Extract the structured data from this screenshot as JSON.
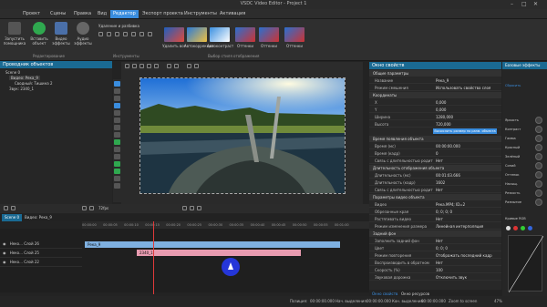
{
  "window": {
    "title": "VSDC Video Editor - Project 1"
  },
  "menu": {
    "tabs": [
      "Проект",
      "Сцены",
      "Правка",
      "Вид",
      "Редактор",
      "Экспорт проекта",
      "Инструменты",
      "Активация"
    ],
    "active": "Редактор"
  },
  "ribbon": {
    "buttons": [
      "Запустить помощника",
      "Вставить объект",
      "Видео эффекты",
      "Аудио эффекты"
    ],
    "group_edit": "Редактирование",
    "group_tools": "Инструменты",
    "delete_label": "Удаление и разбивка",
    "group_styles": "Выбор стиля отображения",
    "effects": [
      "Удалить все",
      "Автокоррекция",
      "Автоконтраст",
      "Оттенки",
      "Оттенки",
      "Оттенки"
    ]
  },
  "object_explorer": {
    "title": "Проводник объектов",
    "items": [
      "Scene 0",
      "Видео: Река_9",
      "Сводный: Тишина 2",
      "Звук: 2340_1"
    ]
  },
  "preview": {
    "zoom": "72fps"
  },
  "properties": {
    "title": "Окно свойств",
    "rows": [
      {
        "type": "sect",
        "label": "Общие параметры"
      },
      {
        "type": "row",
        "k": "Название",
        "v": "Река_9"
      },
      {
        "type": "row",
        "k": "Режим смешения",
        "v": "Использовать свойства слоя"
      },
      {
        "type": "sect",
        "label": "Координаты"
      },
      {
        "type": "row",
        "k": "X",
        "v": "0,000"
      },
      {
        "type": "row",
        "k": "Y",
        "v": "0,000"
      },
      {
        "type": "row",
        "k": "Ширина",
        "v": "1280,000"
      },
      {
        "type": "row",
        "k": "Высота",
        "v": "720,000"
      },
      {
        "type": "bar",
        "label": "Вычислить размер по разм. объекта"
      },
      {
        "type": "sect",
        "label": "Время появления объекта"
      },
      {
        "type": "row",
        "k": "Время (мс)",
        "v": "00:00:00.000"
      },
      {
        "type": "row",
        "k": "Время (кадр)",
        "v": "0"
      },
      {
        "type": "row",
        "k": "Связь с длительностью родит",
        "v": "Нет"
      },
      {
        "type": "sect",
        "label": "Длительность отображения объекта"
      },
      {
        "type": "row",
        "k": "Длительность (мс)",
        "v": "00:01:03.666"
      },
      {
        "type": "row",
        "k": "Длительность (кадр)",
        "v": "1602"
      },
      {
        "type": "row",
        "k": "Связь с длительностью родит",
        "v": "Нет"
      },
      {
        "type": "sect",
        "label": "Параметры видео объекта"
      },
      {
        "type": "row",
        "k": "Видео",
        "v": "Река.MP4; ID=2"
      },
      {
        "type": "row",
        "k": "Обрезанные края",
        "v": "0; 0; 0; 0"
      },
      {
        "type": "row",
        "k": "Растягивать видео",
        "v": "Нет"
      },
      {
        "type": "row",
        "k": "Режим изменения размера",
        "v": "Линейная интерполяция"
      },
      {
        "type": "sect",
        "label": "Задний фон"
      },
      {
        "type": "row",
        "k": "Заполнить задний фон",
        "v": "Нет"
      },
      {
        "type": "row",
        "k": "Цвет",
        "v": "0; 0; 0"
      },
      {
        "type": "row",
        "k": "Режим повторения",
        "v": "Отображать последний кадр"
      },
      {
        "type": "row",
        "k": "Воспроизводить в обратном",
        "v": "Нет"
      },
      {
        "type": "row",
        "k": "Скорость (%)",
        "v": "100"
      },
      {
        "type": "row",
        "k": "Звуковая дорожка",
        "v": "Отключить звук"
      }
    ],
    "tabs": [
      "Окно свойств",
      "Окно ресурсов"
    ]
  },
  "basic_effects": {
    "title": "Базовые эффекты",
    "items": [
      "Яркость",
      "Контраст",
      "Гамма",
      "Красный",
      "Зелёный",
      "Синий",
      "Оттенок",
      "Насыщ.",
      "Резкость",
      "Размытие"
    ],
    "curves": "Кривые RGB",
    "reset": "Сбросить"
  },
  "timeline": {
    "tabs": [
      "Scene 0",
      "Видео: Река_9"
    ],
    "ruler": [
      "00:00:00",
      "00:00:05",
      "00:00:10",
      "00:00:15",
      "00:00:20",
      "00:00:25",
      "00:00:30",
      "00:00:35",
      "00:00:40",
      "00:00:45",
      "00:00:50",
      "00:00:55",
      "00:01:00"
    ],
    "tracks": [
      {
        "head": "Неко... Слой 26",
        "clip": "Река_9"
      },
      {
        "head": "Неко... Слой 25",
        "clip": "2340_1"
      },
      {
        "head": "Неко... Слой 22",
        "clip": ""
      }
    ]
  },
  "status": {
    "position_label": "Позиция:",
    "position": "00:00:00.000",
    "start_label": "Нач. выделения:",
    "start": "00:00:00.000",
    "end_label": "Кон. выделения:",
    "end": "00:00:00.000",
    "zoom_label": "Zoom to screen",
    "zoom": "47%"
  }
}
